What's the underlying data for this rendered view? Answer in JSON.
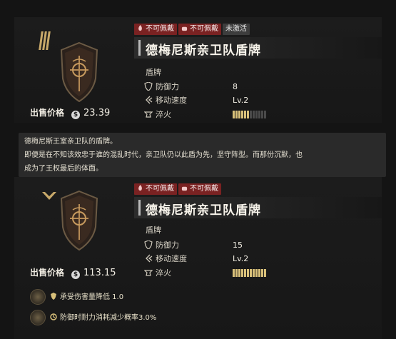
{
  "item_top": {
    "tags": [
      {
        "label": "不可佩戴",
        "style": "red",
        "icon": "flame-icon"
      },
      {
        "label": "不可佩戴",
        "style": "red",
        "icon": "fist-icon"
      },
      {
        "label": "未激活",
        "style": "gray"
      }
    ],
    "name": "德梅尼斯亲卫队盾牌",
    "category": "盾牌",
    "stats": [
      {
        "icon": "shield-icon",
        "label": "防御力",
        "value": "8"
      },
      {
        "icon": "speed-icon",
        "label": "移动速度",
        "value": "Lv.2"
      },
      {
        "icon": "anvil-icon",
        "label": "淬火",
        "level_fraction": 0.5
      }
    ],
    "sell_label": "出售价格",
    "sell_value": "23.39",
    "rank_icon": "rank-bars-icon"
  },
  "description": {
    "line1": "德梅尼斯王室亲卫队的盾牌。",
    "line2": "即便是在不知该效忠于谁的混乱时代，亲卫队仍以此盾为先，坚守阵型。而那份沉默，也",
    "line3": "成为了王权最后的体面。"
  },
  "item_bottom": {
    "tags": [
      {
        "label": "不可佩戴",
        "style": "red",
        "icon": "flame-icon"
      },
      {
        "label": "不可佩戴",
        "style": "red",
        "icon": "fist-icon"
      }
    ],
    "name": "德梅尼斯亲卫队盾牌",
    "category": "盾牌",
    "stats": [
      {
        "icon": "shield-icon",
        "label": "防御力",
        "value": "15"
      },
      {
        "icon": "speed-icon",
        "label": "移动速度",
        "value": "Lv.2"
      },
      {
        "icon": "anvil-icon",
        "label": "淬火",
        "level_fraction": 1.0
      }
    ],
    "sell_label": "出售价格",
    "sell_value": "113.15",
    "rank_icon": "chevron-rank-icon",
    "passives": [
      {
        "text": "承受伤害量降低 1.0"
      },
      {
        "text": "防御时耐力消耗减少概率3.0%"
      }
    ]
  },
  "colors": {
    "accent_gold": "#d8c07a",
    "tag_red": "#7a2222",
    "tag_gray": "#3d3d3d"
  }
}
